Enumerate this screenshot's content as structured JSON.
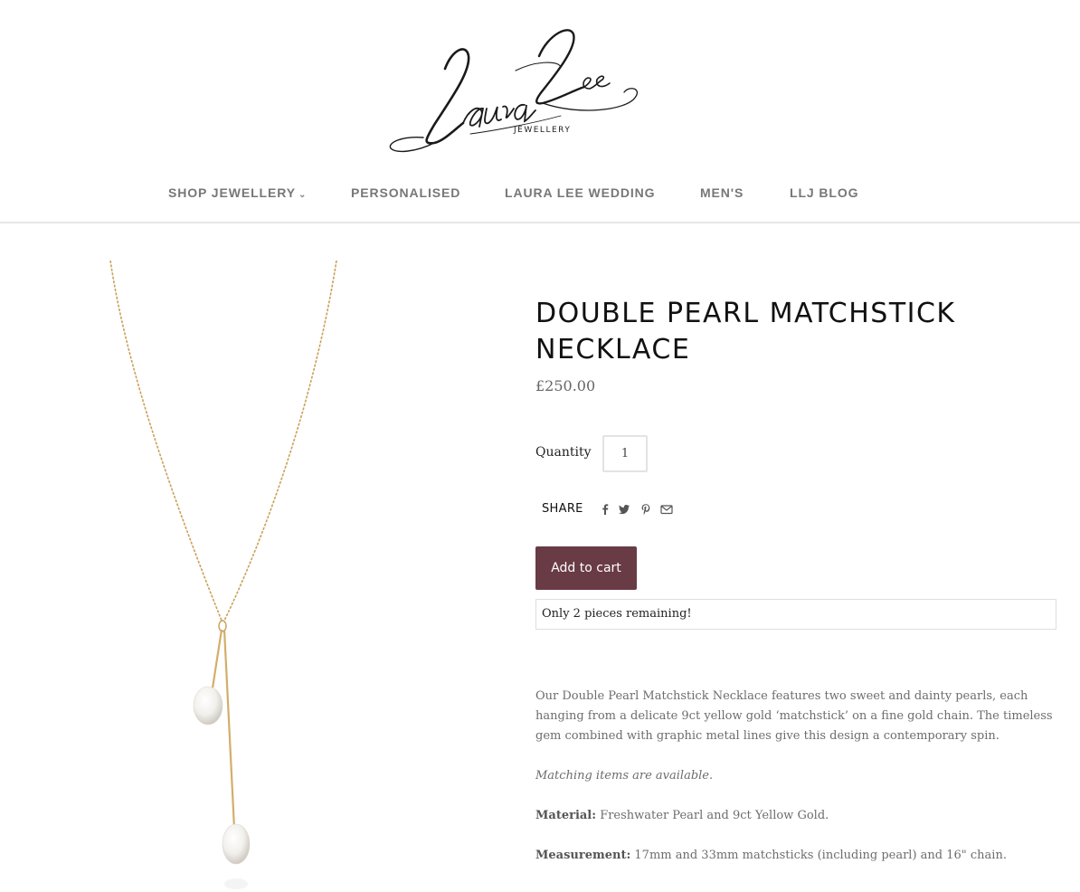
{
  "brand": {
    "logo_script": "Laura Lee",
    "logo_sub": "JEWELLERY"
  },
  "nav": {
    "items": [
      {
        "label": "SHOP JEWELLERY",
        "has_dropdown": true,
        "icon": "chevron-down-icon"
      },
      {
        "label": "PERSONALISED"
      },
      {
        "label": "LAURA LEE WEDDING"
      },
      {
        "label": "MEN'S"
      },
      {
        "label": "LLJ BLOG"
      }
    ]
  },
  "product": {
    "title": "DOUBLE PEARL MATCHSTICK NECKLACE",
    "price": "£250.00",
    "quantity_label": "Quantity",
    "quantity_value": "1",
    "share_label": "SHARE",
    "share_icons": [
      "facebook-icon",
      "twitter-icon",
      "pinterest-icon",
      "email-icon"
    ],
    "add_to_cart_label": "Add to cart",
    "stock_message": "Only 2 pieces remaining!",
    "description": "Our Double Pearl Matchstick Necklace features two sweet and dainty pearls, each hanging from a delicate 9ct yellow gold ‘matchstick’ on a fine gold chain. The timeless gem combined with graphic metal lines give this design a contemporary spin.",
    "matching_note": "Matching items are available.",
    "material_label": "Material:",
    "material_value": "Freshwater Pearl and 9ct Yellow Gold.",
    "measurement_label": "Measurement:",
    "measurement_value": "17mm and 33mm matchsticks (including pearl) and 16\" chain."
  },
  "colors": {
    "accent": "#693b45",
    "nav_text": "#777777",
    "body_text": "#6d6d6d"
  }
}
